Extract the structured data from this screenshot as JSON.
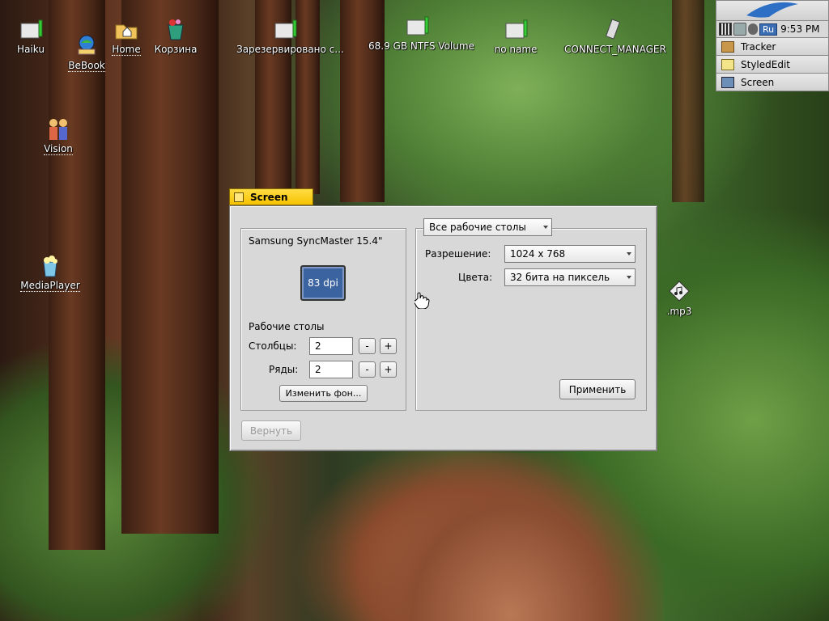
{
  "desktop": {
    "icons": [
      {
        "label": "Haiku"
      },
      {
        "label": "BeBook"
      },
      {
        "label": "Home"
      },
      {
        "label": "Корзина"
      },
      {
        "label": "Зарезервировано с..."
      },
      {
        "label": "68.9 GB NTFS Volume"
      },
      {
        "label": "no name"
      },
      {
        "label": "CONNECT_MANAGER"
      },
      {
        "label": "Vision"
      },
      {
        "label": "MediaPlayer"
      },
      {
        "label": ".mp3"
      }
    ]
  },
  "deskbar": {
    "lang": "Ru",
    "clock": "9:53 PM",
    "items": [
      {
        "label": "Tracker"
      },
      {
        "label": "StyledEdit"
      },
      {
        "label": "Screen"
      }
    ]
  },
  "window": {
    "title": "Screen",
    "monitor_name": "Samsung SyncMaster 15.4\"",
    "dpi": "83 dpi",
    "workspaces_heading": "Рабочие столы",
    "columns_label": "Столбцы:",
    "columns_value": "2",
    "rows_label": "Ряды:",
    "rows_value": "2",
    "minus": "-",
    "plus": "+",
    "change_background": "Изменить фон...",
    "scope_menu": "Все рабочие столы",
    "resolution_label": "Разрешение:",
    "resolution_value": "1024 x 768",
    "colors_label": "Цвета:",
    "colors_value": "32 бита на пиксель",
    "apply": "Применить",
    "revert": "Вернуть"
  },
  "colors": {
    "tab": "#f6c200",
    "dpi_box": "#3a63a0",
    "panel": "#d8d8d8"
  }
}
